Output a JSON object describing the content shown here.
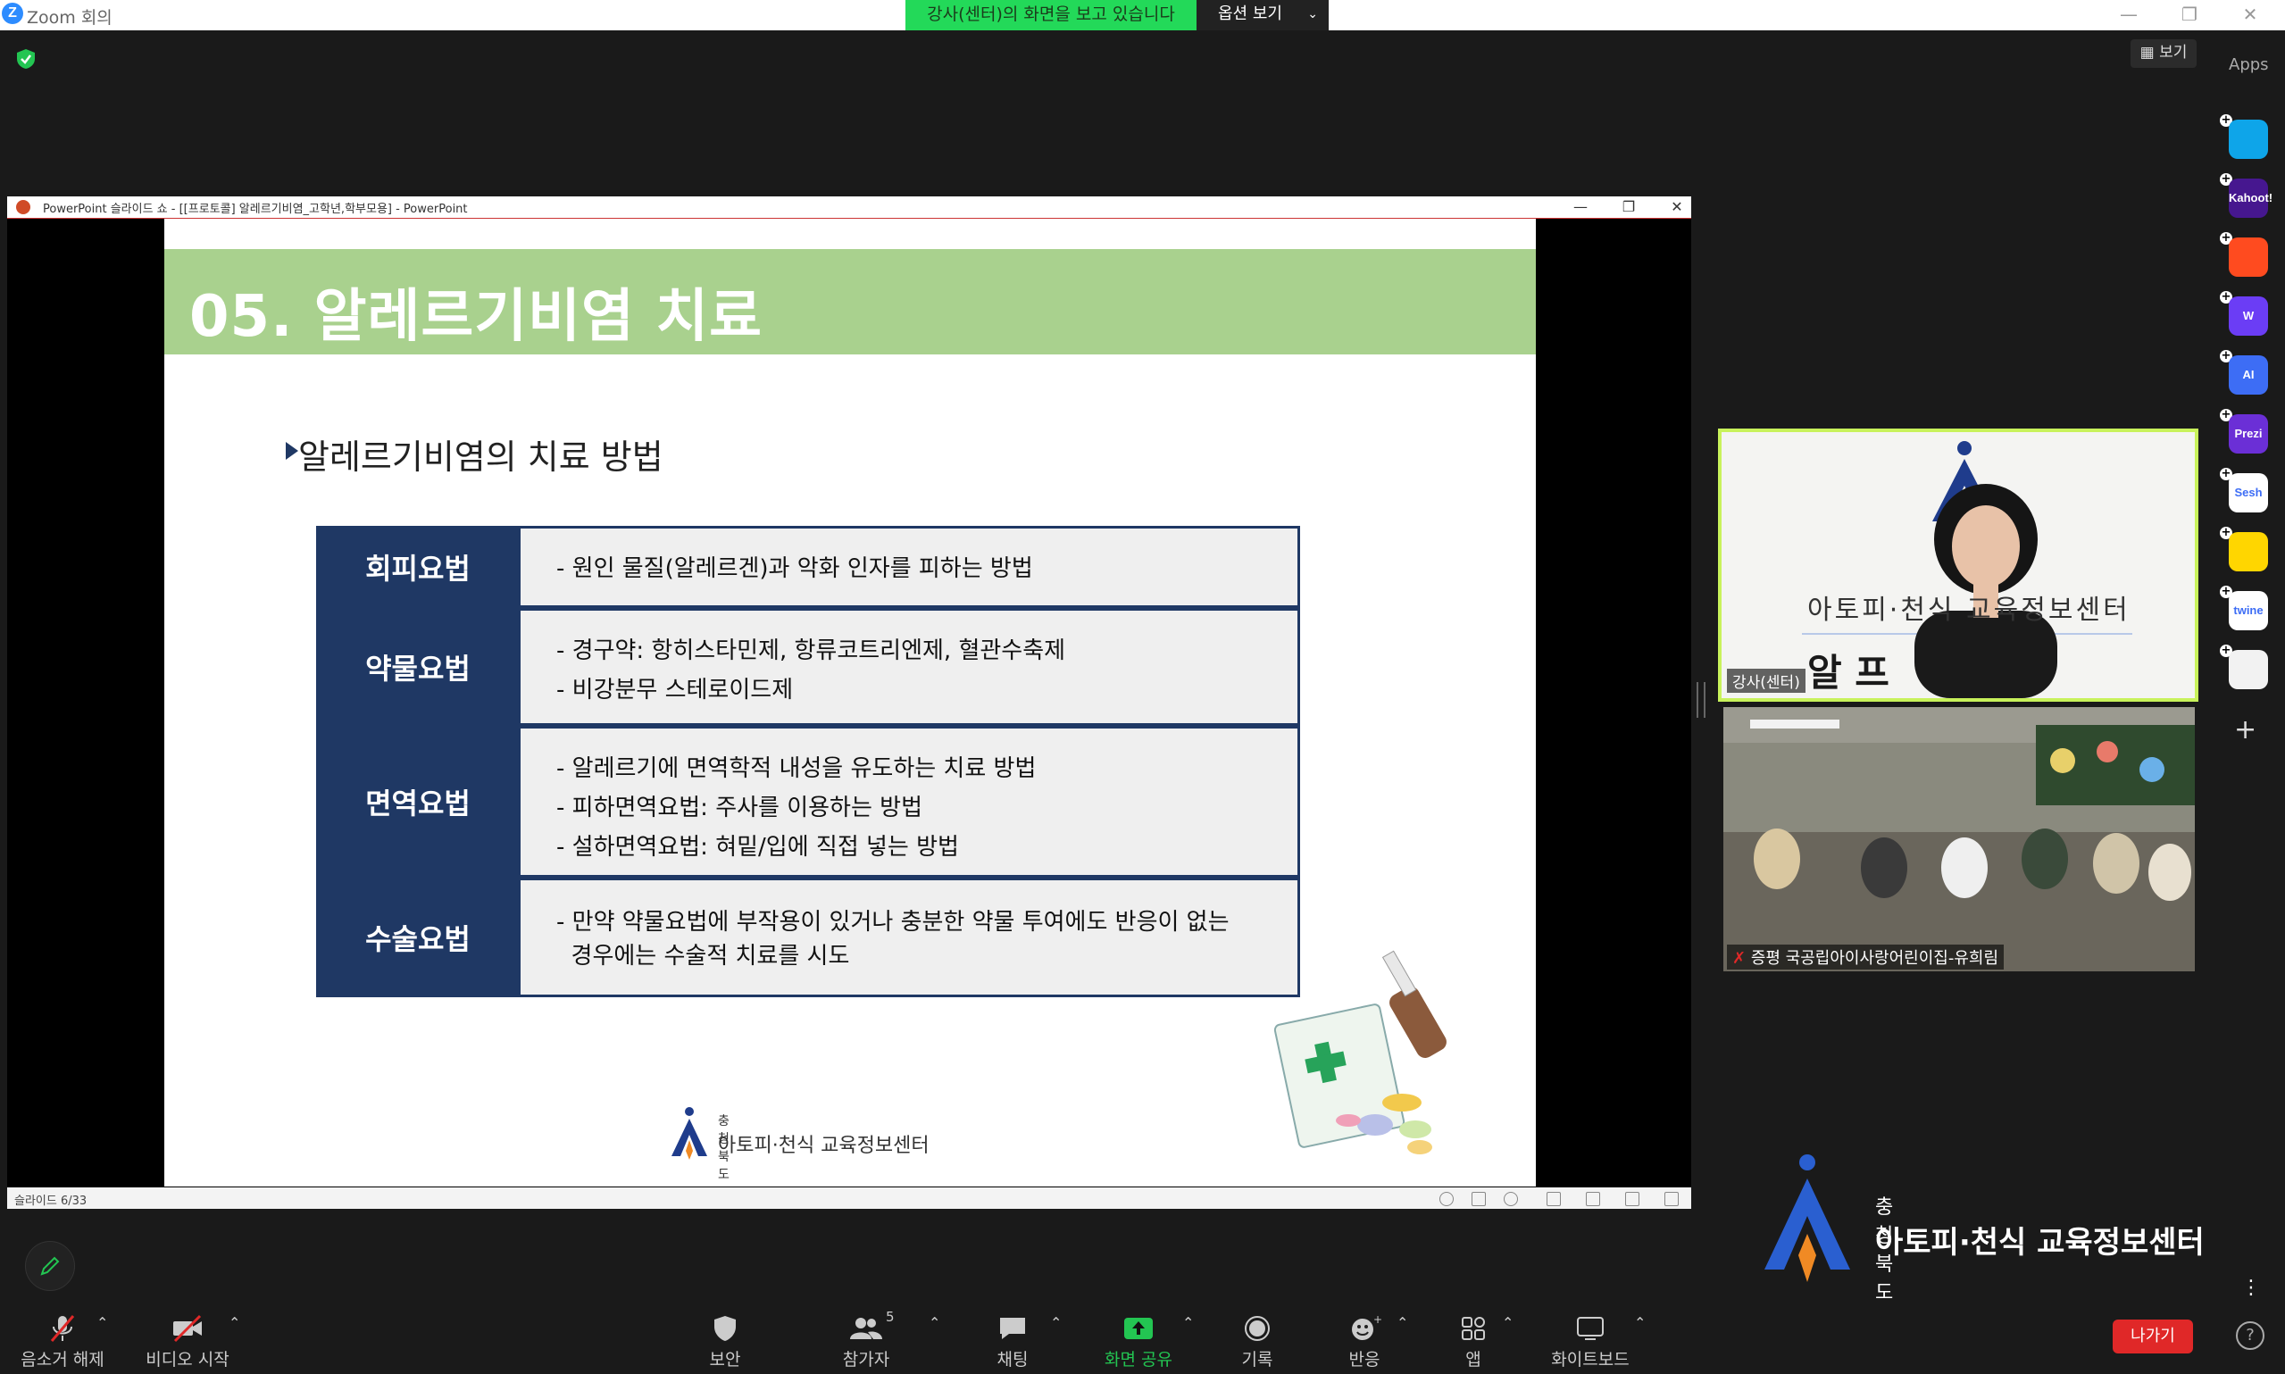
{
  "window": {
    "app_title": "Zoom 회의",
    "share_banner": "강사(센터)의 화면을 보고 있습니다",
    "view_options": "옵션 보기",
    "min": "—",
    "restore": "❐",
    "close": "✕"
  },
  "top": {
    "view_button": "보기",
    "apps_label": "Apps"
  },
  "apps": [
    {
      "name": "Pitch",
      "text": "",
      "color": "#0ea5e9"
    },
    {
      "name": "Kahoot!",
      "text": "Kahoot!",
      "color": "#46178f"
    },
    {
      "name": "App",
      "text": "",
      "color": "#ff4b1f"
    },
    {
      "name": "Wooclap",
      "text": "W",
      "color": "#6b3df5"
    },
    {
      "name": "AI",
      "text": "AI",
      "color": "#3d6df5"
    },
    {
      "name": "Prezi",
      "text": "Prezi",
      "color": "#6b2fd6"
    },
    {
      "name": "Sesh",
      "text": "Sesh",
      "color": "#ffffff"
    },
    {
      "name": "Mood",
      "text": "",
      "color": "#ffd600"
    },
    {
      "name": "twine",
      "text": "twine",
      "color": "#ffffff"
    },
    {
      "name": "Apps",
      "text": "",
      "color": "#f2f2f2"
    }
  ],
  "add_app": "+",
  "ppt": {
    "title": "PowerPoint 슬라이드 쇼 - [[프로토콜] 알레르기비염_고학년,학부모용] - PowerPoint",
    "min": "—",
    "restore": "❐",
    "close": "✕",
    "slide_counter": "슬라이드 6/33"
  },
  "slide": {
    "title": "05. 알레르기비염 치료",
    "subtitle": "알레르기비염의 치료 방법",
    "rows": [
      {
        "label": "회피요법",
        "lines": [
          "- 원인 물질(알레르겐)과 악화 인자를 피하는 방법"
        ]
      },
      {
        "label": "약물요법",
        "lines": [
          "- 경구약: 항히스타민제, 항류코트리엔제, 혈관수축제",
          "- 비강분무 스테로이드제"
        ]
      },
      {
        "label": "면역요법",
        "lines": [
          "- 알레르기에 면역학적 내성을 유도하는 치료 방법",
          "- 피하면역요법: 주사를 이용하는 방법",
          "- 설하면역요법: 혀밑/입에 직접 넣는 방법"
        ]
      },
      {
        "label": "수술요법",
        "lines": [
          "- 만약 약물요법에 부작용이 있거나 충분한 약물 투여에도 반응이 없는",
          "  경우에는 수술적 치료를 시도"
        ]
      }
    ],
    "logo_region": "충청북도",
    "logo_name": "아토피·천식 교육정보센터"
  },
  "videos": {
    "speaker_label": "강사(센터)",
    "speaker_bg_text": "아토피·천식 교육정보센터",
    "speaker_bg_text2": "알 프",
    "group_label": "증평 국공립아이사랑어린이집-유희림"
  },
  "center_logo": {
    "region": "충청북도",
    "name": "아토피·천식 교육정보센터"
  },
  "toolbar": {
    "mute": "음소거 해제",
    "video": "비디오 시작",
    "security": "보안",
    "participants": "참가자",
    "participants_count": "5",
    "chat": "채팅",
    "share": "화면 공유",
    "record": "기록",
    "reactions": "반응",
    "apps": "앱",
    "whiteboard": "화이트보드",
    "leave": "나가기",
    "help": "?",
    "more": "⋮"
  },
  "colors": {
    "share_green": "#23d959",
    "slide_green": "#a9d18e",
    "navy": "#1f3864",
    "leave_red": "#e02828",
    "speaker_border": "#c8f25b"
  }
}
